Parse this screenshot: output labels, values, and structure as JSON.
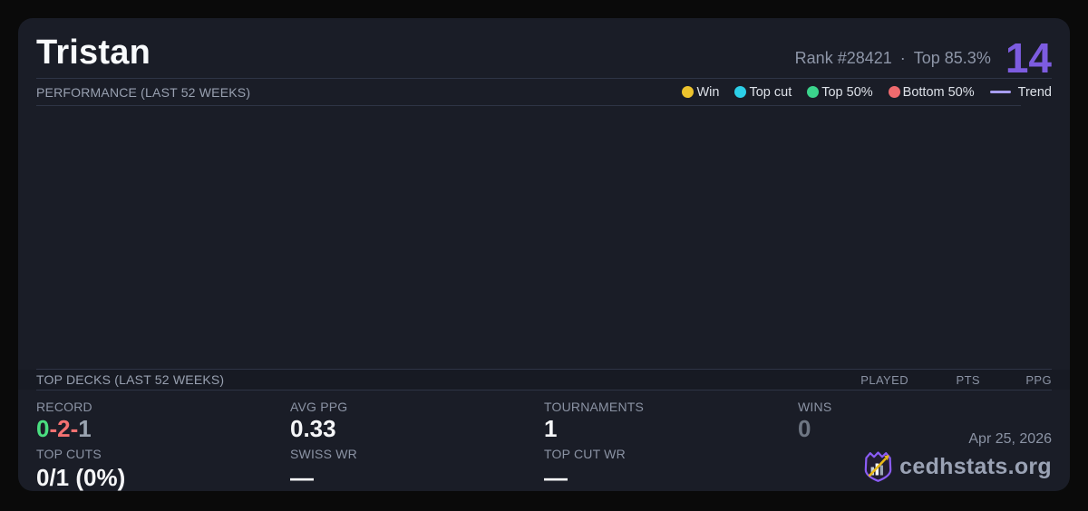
{
  "colors": {
    "page_bg": "#0a0a0a",
    "card_bg": "#1a1d27",
    "divider": "#2e3445",
    "accent_purple": "#7d5ce0",
    "trend_purple": "#a79df0",
    "legend_win_yellow": "#edc32d",
    "legend_topcut_cyan": "#2ccfe8",
    "legend_top50_green": "#3bd48c",
    "legend_bottom50_red": "#ef6a6e",
    "record_win_green": "#4ade80",
    "record_loss_red": "#f47171",
    "record_draw_gray": "#9aa3b0",
    "muted_value_gray": "#6e7683"
  },
  "header": {
    "title": "Tristan",
    "rank": "Rank #28421",
    "separator": "·",
    "top_percent": "Top 85.3%",
    "score": "14"
  },
  "performance": {
    "section_title": "PERFORMANCE (LAST 52 WEEKS)",
    "legend": [
      {
        "label": "Win",
        "color": "#edc32d",
        "type": "dot"
      },
      {
        "label": "Top cut",
        "color": "#2ccfe8",
        "type": "dot"
      },
      {
        "label": "Top 50%",
        "color": "#3bd48c",
        "type": "dot"
      },
      {
        "label": "Bottom 50%",
        "color": "#ef6a6e",
        "type": "dot"
      },
      {
        "label": "Trend",
        "color": "#a79df0",
        "type": "line"
      }
    ]
  },
  "chart_data": {
    "type": "scatter",
    "title": "PERFORMANCE (LAST 52 WEEKS)",
    "legend_entries": [
      "Win",
      "Top cut",
      "Top 50%",
      "Bottom 50%",
      "Trend"
    ],
    "series": [],
    "points_visible": 0
  },
  "top_decks": {
    "section_title": "TOP DECKS (LAST 52 WEEKS)",
    "columns": [
      "PLAYED",
      "PTS",
      "PPG"
    ],
    "rows": []
  },
  "stats": {
    "record": {
      "label": "RECORD",
      "wins": "0",
      "sep1": "-",
      "losses": "2",
      "sep2": "-",
      "draws": "1"
    },
    "avg_ppg": {
      "label": "AVG PPG",
      "value": "0.33"
    },
    "tournaments": {
      "label": "TOURNAMENTS",
      "value": "1"
    },
    "wins": {
      "label": "WINS",
      "value": "0"
    },
    "top_cuts": {
      "label": "TOP CUTS",
      "value": "0/1 (0%)"
    },
    "swiss_wr": {
      "label": "SWISS WR",
      "value": "—"
    },
    "top_cut_wr": {
      "label": "TOP CUT WR",
      "value": "—"
    }
  },
  "footer": {
    "date": "Apr 25, 2026",
    "brand": "cedhstats.org"
  }
}
